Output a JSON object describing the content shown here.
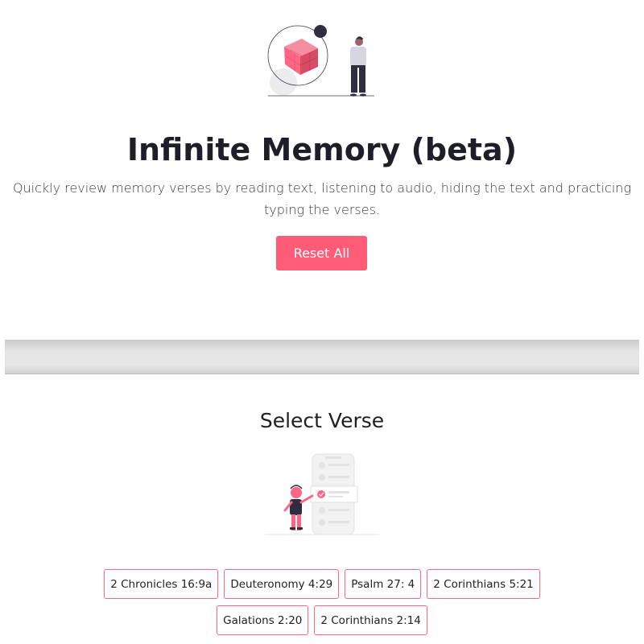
{
  "hero": {
    "title": "Infinite Memory (beta)",
    "description": "Quickly review memory verses by reading text, listening to audio, hiding the text and practicing typing the verses.",
    "reset_label": "Reset All"
  },
  "select": {
    "title": "Select Verse",
    "verses": [
      "2 Chronicles 16:9a",
      "Deuteronomy 4:29",
      "Psalm 27: 4",
      "2 Corinthians 5:21",
      "Galations 2:20",
      "2 Corinthians 2:14"
    ]
  },
  "colors": {
    "accent": "#ff5c77",
    "title": "#1e1e28"
  },
  "icons": {
    "hero": "cube-person-illustration",
    "select": "phone-checklist-illustration"
  }
}
